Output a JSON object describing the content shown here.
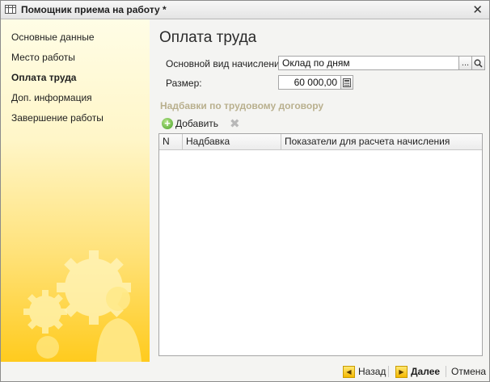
{
  "window": {
    "title": "Помощник приема на работу *"
  },
  "sidebar": {
    "items": [
      {
        "label": "Основные данные",
        "active": false
      },
      {
        "label": "Место работы",
        "active": false
      },
      {
        "label": "Оплата труда",
        "active": true
      },
      {
        "label": "Доп. информация",
        "active": false
      },
      {
        "label": "Завершение работы",
        "active": false
      }
    ]
  },
  "main": {
    "title": "Оплата труда",
    "accrual": {
      "label": "Основной вид начисления:",
      "value": "Оклад по дням",
      "select_label": "...",
      "open_icon": "magnifier-icon"
    },
    "amount": {
      "label": "Размер:",
      "value": "60 000,00",
      "calc_icon": "calculator-icon"
    },
    "allowances": {
      "section_title": "Надбавки по трудовому договору",
      "add_label": "Добавить",
      "delete_icon": "delete-icon",
      "columns": [
        "N",
        "Надбавка",
        "Показатели для расчета начисления"
      ],
      "rows": []
    }
  },
  "footer": {
    "back_label": "Назад",
    "next_label": "Далее",
    "cancel_label": "Отмена"
  },
  "colors": {
    "sidebar_top": "#fffde6",
    "sidebar_bottom": "#ffcb1e",
    "section_title": "#b9b08e",
    "accent_button": "#f5b800"
  }
}
